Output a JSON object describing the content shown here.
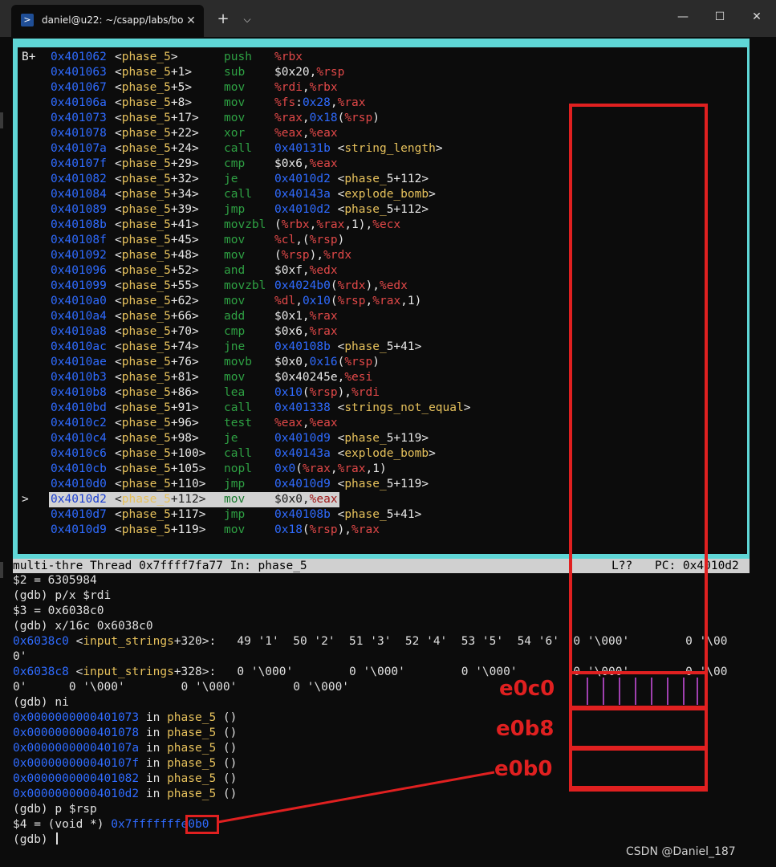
{
  "window": {
    "tab_title": "daniel@u22: ~/csapp/labs/bo",
    "new_tab": "+",
    "dropdown": "⌵",
    "close_tab": "✕",
    "minimize": "—",
    "maximize": "☐",
    "close": "✕"
  },
  "asm": [
    {
      "mark": "B+",
      "addr": "0x401062",
      "fn": "phase_5",
      "off": "",
      "mn": "push",
      "op": "%rbx"
    },
    {
      "mark": "",
      "addr": "0x401063",
      "fn": "phase_5",
      "off": "+1",
      "mn": "sub",
      "op": "$0x20,%rsp"
    },
    {
      "mark": "",
      "addr": "0x401067",
      "fn": "phase_5",
      "off": "+5",
      "mn": "mov",
      "op": "%rdi,%rbx"
    },
    {
      "mark": "",
      "addr": "0x40106a",
      "fn": "phase_5",
      "off": "+8",
      "mn": "mov",
      "op": "%fs:0x28,%rax"
    },
    {
      "mark": "",
      "addr": "0x401073",
      "fn": "phase_5",
      "off": "+17",
      "mn": "mov",
      "op": "%rax,0x18(%rsp)"
    },
    {
      "mark": "",
      "addr": "0x401078",
      "fn": "phase_5",
      "off": "+22",
      "mn": "xor",
      "op": "%eax,%eax"
    },
    {
      "mark": "",
      "addr": "0x40107a",
      "fn": "phase_5",
      "off": "+24",
      "mn": "call",
      "op": "0x40131b <string_length>"
    },
    {
      "mark": "",
      "addr": "0x40107f",
      "fn": "phase_5",
      "off": "+29",
      "mn": "cmp",
      "op": "$0x6,%eax"
    },
    {
      "mark": "",
      "addr": "0x401082",
      "fn": "phase_5",
      "off": "+32",
      "mn": "je",
      "op": "0x4010d2 <phase_5+112>"
    },
    {
      "mark": "",
      "addr": "0x401084",
      "fn": "phase_5",
      "off": "+34",
      "mn": "call",
      "op": "0x40143a <explode_bomb>"
    },
    {
      "mark": "",
      "addr": "0x401089",
      "fn": "phase_5",
      "off": "+39",
      "mn": "jmp",
      "op": "0x4010d2 <phase_5+112>"
    },
    {
      "mark": "",
      "addr": "0x40108b",
      "fn": "phase_5",
      "off": "+41",
      "mn": "movzbl",
      "op": "(%rbx,%rax,1),%ecx"
    },
    {
      "mark": "",
      "addr": "0x40108f",
      "fn": "phase_5",
      "off": "+45",
      "mn": "mov",
      "op": "%cl,(%rsp)"
    },
    {
      "mark": "",
      "addr": "0x401092",
      "fn": "phase_5",
      "off": "+48",
      "mn": "mov",
      "op": "(%rsp),%rdx"
    },
    {
      "mark": "",
      "addr": "0x401096",
      "fn": "phase_5",
      "off": "+52",
      "mn": "and",
      "op": "$0xf,%edx"
    },
    {
      "mark": "",
      "addr": "0x401099",
      "fn": "phase_5",
      "off": "+55",
      "mn": "movzbl",
      "op": "0x4024b0(%rdx),%edx"
    },
    {
      "mark": "",
      "addr": "0x4010a0",
      "fn": "phase_5",
      "off": "+62",
      "mn": "mov",
      "op": "%dl,0x10(%rsp,%rax,1)"
    },
    {
      "mark": "",
      "addr": "0x4010a4",
      "fn": "phase_5",
      "off": "+66",
      "mn": "add",
      "op": "$0x1,%rax"
    },
    {
      "mark": "",
      "addr": "0x4010a8",
      "fn": "phase_5",
      "off": "+70",
      "mn": "cmp",
      "op": "$0x6,%rax"
    },
    {
      "mark": "",
      "addr": "0x4010ac",
      "fn": "phase_5",
      "off": "+74",
      "mn": "jne",
      "op": "0x40108b <phase_5+41>"
    },
    {
      "mark": "",
      "addr": "0x4010ae",
      "fn": "phase_5",
      "off": "+76",
      "mn": "movb",
      "op": "$0x0,0x16(%rsp)"
    },
    {
      "mark": "",
      "addr": "0x4010b3",
      "fn": "phase_5",
      "off": "+81",
      "mn": "mov",
      "op": "$0x40245e,%esi"
    },
    {
      "mark": "",
      "addr": "0x4010b8",
      "fn": "phase_5",
      "off": "+86",
      "mn": "lea",
      "op": "0x10(%rsp),%rdi"
    },
    {
      "mark": "",
      "addr": "0x4010bd",
      "fn": "phase_5",
      "off": "+91",
      "mn": "call",
      "op": "0x401338 <strings_not_equal>"
    },
    {
      "mark": "",
      "addr": "0x4010c2",
      "fn": "phase_5",
      "off": "+96",
      "mn": "test",
      "op": "%eax,%eax"
    },
    {
      "mark": "",
      "addr": "0x4010c4",
      "fn": "phase_5",
      "off": "+98",
      "mn": "je",
      "op": "0x4010d9 <phase_5+119>"
    },
    {
      "mark": "",
      "addr": "0x4010c6",
      "fn": "phase_5",
      "off": "+100",
      "mn": "call",
      "op": "0x40143a <explode_bomb>"
    },
    {
      "mark": "",
      "addr": "0x4010cb",
      "fn": "phase_5",
      "off": "+105",
      "mn": "nopl",
      "op": "0x0(%rax,%rax,1)"
    },
    {
      "mark": "",
      "addr": "0x4010d0",
      "fn": "phase_5",
      "off": "+110",
      "mn": "jmp",
      "op": "0x4010d9 <phase_5+119>"
    },
    {
      "mark": ">",
      "addr": "0x4010d2",
      "fn": "phase_5",
      "off": "+112",
      "mn": "mov",
      "op": "$0x0,%eax"
    },
    {
      "mark": "",
      "addr": "0x4010d7",
      "fn": "phase_5",
      "off": "+117",
      "mn": "jmp",
      "op": "0x40108b <phase_5+41>"
    },
    {
      "mark": "",
      "addr": "0x4010d9",
      "fn": "phase_5",
      "off": "+119",
      "mn": "mov",
      "op": "0x18(%rsp),%rax"
    }
  ],
  "status": {
    "left": "multi-thre Thread 0x7ffff7fa77 In: phase_5",
    "line": "L??",
    "pc": "PC: 0x4010d2"
  },
  "console": {
    "l1": "$2 = 6305984",
    "l2": "(gdb) p/x $rdi",
    "l3": "$3 = 0x6038c0",
    "l4": "(gdb) x/16c 0x6038c0",
    "l5_addr": "0x6038c0",
    "l5_sym": "input_strings",
    "l5_off": "+320",
    "l5_rest": ">:   49 '1'  50 '2'  51 '3'  52 '4'  53 '5'  54 '6'  0 '\\000'        0 '\\00",
    "l6": "0'",
    "l7_addr": "0x6038c8",
    "l7_sym": "input_strings",
    "l7_off": "+328",
    "l7_rest": ">:   0 '\\000'        0 '\\000'        0 '\\000'        0 '\\000'        0 '\\00",
    "l8": "0'      0 '\\000'        0 '\\000'        0 '\\000'",
    "l9": "(gdb) ni",
    "ni": [
      {
        "addr": "0x0000000000401073",
        "fn": "phase_5"
      },
      {
        "addr": "0x0000000000401078",
        "fn": "phase_5"
      },
      {
        "addr": "0x000000000040107a",
        "fn": "phase_5"
      },
      {
        "addr": "0x000000000040107f",
        "fn": "phase_5"
      },
      {
        "addr": "0x0000000000401082",
        "fn": "phase_5"
      },
      {
        "addr": "0x00000000004010d2",
        "fn": "phase_5"
      }
    ],
    "in_word": " in ",
    "paren": " ()",
    "l16": "(gdb) p $rsp",
    "l17_pre": "$4 = (void *) ",
    "l17_addr": "0x7fffffffe0b0",
    "l18": "(gdb) "
  },
  "annotations": {
    "e0c0": "e0c0",
    "e0b8": "e0b8",
    "e0b0": "e0b0",
    "watermark": "CSDN @Daniel_187"
  }
}
